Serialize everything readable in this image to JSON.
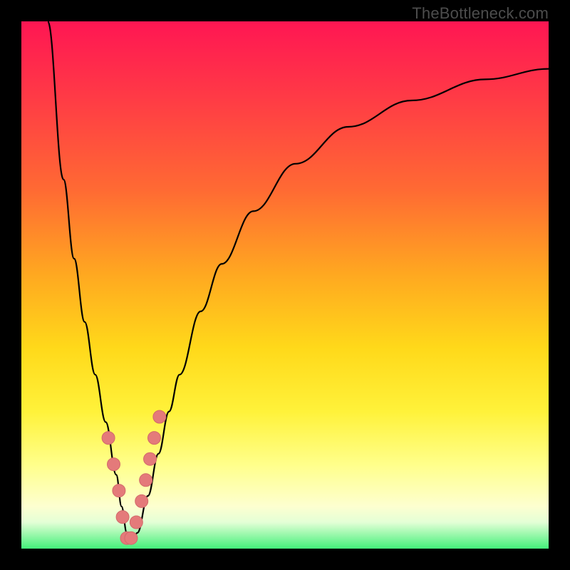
{
  "watermark": "TheBottleneck.com",
  "colors": {
    "frame": "#000000",
    "curve": "#000000",
    "dot_fill": "#e47a7a",
    "dot_stroke": "#d26a6a",
    "gradient_stops": [
      "#ff1653",
      "#ff3448",
      "#ff6a33",
      "#ffa820",
      "#ffd91a",
      "#fff23a",
      "#ffff8a",
      "#fdffd0",
      "#e4ffd6",
      "#44f07a"
    ]
  },
  "chart_data": {
    "type": "line",
    "title": "",
    "xlabel": "",
    "ylabel": "",
    "xlim": [
      0,
      100
    ],
    "ylim": [
      0,
      100
    ],
    "series": [
      {
        "name": "bottleneck-curve",
        "x": [
          5,
          8,
          10,
          12,
          14,
          16,
          18,
          19,
          20,
          21,
          22,
          24,
          26,
          28,
          30,
          34,
          38,
          44,
          52,
          62,
          74,
          88,
          100
        ],
        "values": [
          100,
          70,
          55,
          43,
          33,
          24,
          14,
          8,
          3,
          1,
          3,
          10,
          18,
          26,
          33,
          45,
          54,
          64,
          73,
          80,
          85,
          89,
          91
        ]
      }
    ],
    "markers": {
      "name": "highlighted-points",
      "x": [
        16.5,
        17.5,
        18.5,
        19.2,
        20.0,
        20.8,
        21.8,
        22.8,
        23.6,
        24.4,
        25.2,
        26.2
      ],
      "values": [
        21,
        16,
        11,
        6,
        2,
        2,
        5,
        9,
        13,
        17,
        21,
        25
      ]
    }
  }
}
